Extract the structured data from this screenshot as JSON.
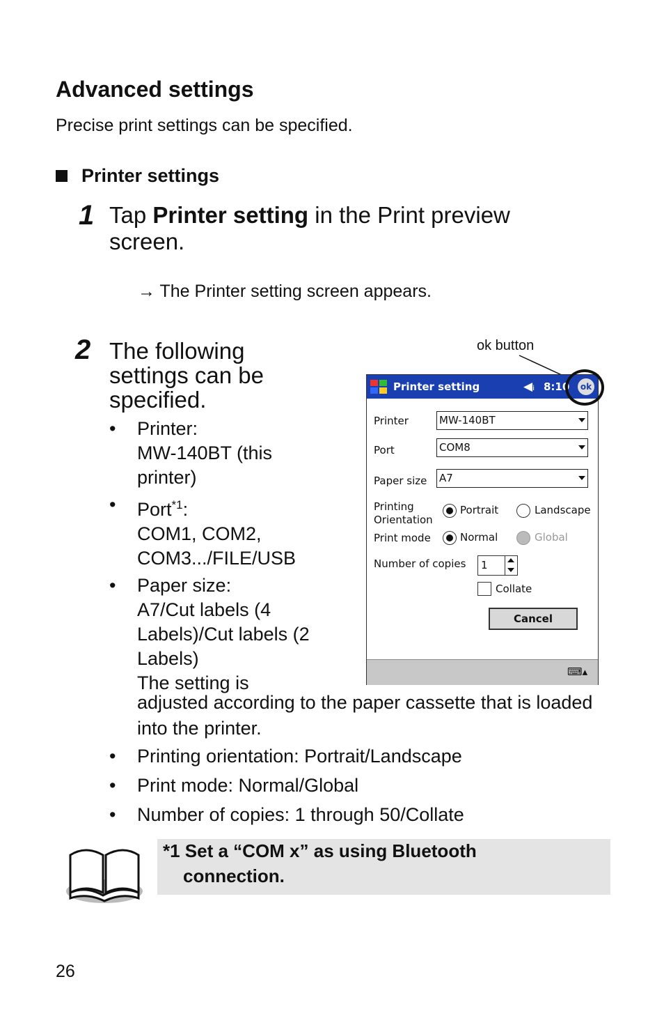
{
  "heading": "Advanced settings",
  "intro": "Precise print settings can be specified.",
  "section": "Printer settings",
  "step1": {
    "num": "1",
    "pre": "Tap ",
    "bold": "Printer setting",
    "post": " in the Print preview screen.",
    "result": "→  The Printer setting screen appears."
  },
  "step2": {
    "num": "2",
    "text": "The following settings can be specified.",
    "bullets": [
      {
        "label": "Printer:",
        "value": "MW-140BT (this printer)"
      },
      {
        "label": "Port",
        "sup": "*1",
        "label_end": ":",
        "value": "COM1, COM2, COM3.../FILE/USB"
      },
      {
        "label": "Paper size:",
        "value": "A7/Cut labels (4 Labels)/Cut labels (2 Labels)",
        "extra_start": "The setting is"
      }
    ],
    "continuation": "adjusted according to the paper cassette that is loaded into the printer.",
    "bullets2": [
      "Printing orientation: Portrait/Landscape",
      "Print mode: Normal/Global",
      "Number of copies: 1 through 50/Collate"
    ]
  },
  "callout": "ok button",
  "screen": {
    "title": "Printer setting",
    "time": "8:10",
    "ok": "ok",
    "printer_label": "Printer",
    "printer_value": "MW-140BT",
    "port_label": "Port",
    "port_value": "COM8",
    "paper_label": "Paper size",
    "paper_value": "A7",
    "orientation_label_1": "Printing",
    "orientation_label_2": "Orientation",
    "portrait": "Portrait",
    "landscape": "Landscape",
    "mode_label": "Print mode",
    "normal": "Normal",
    "global": "Global",
    "copies_label": "Number of copies",
    "copies_value": "1",
    "collate": "Collate",
    "cancel": "Cancel"
  },
  "note": {
    "line1": "*1  Set a “COM x” as using Bluetooth",
    "line2": "connection."
  },
  "page_number": "26"
}
